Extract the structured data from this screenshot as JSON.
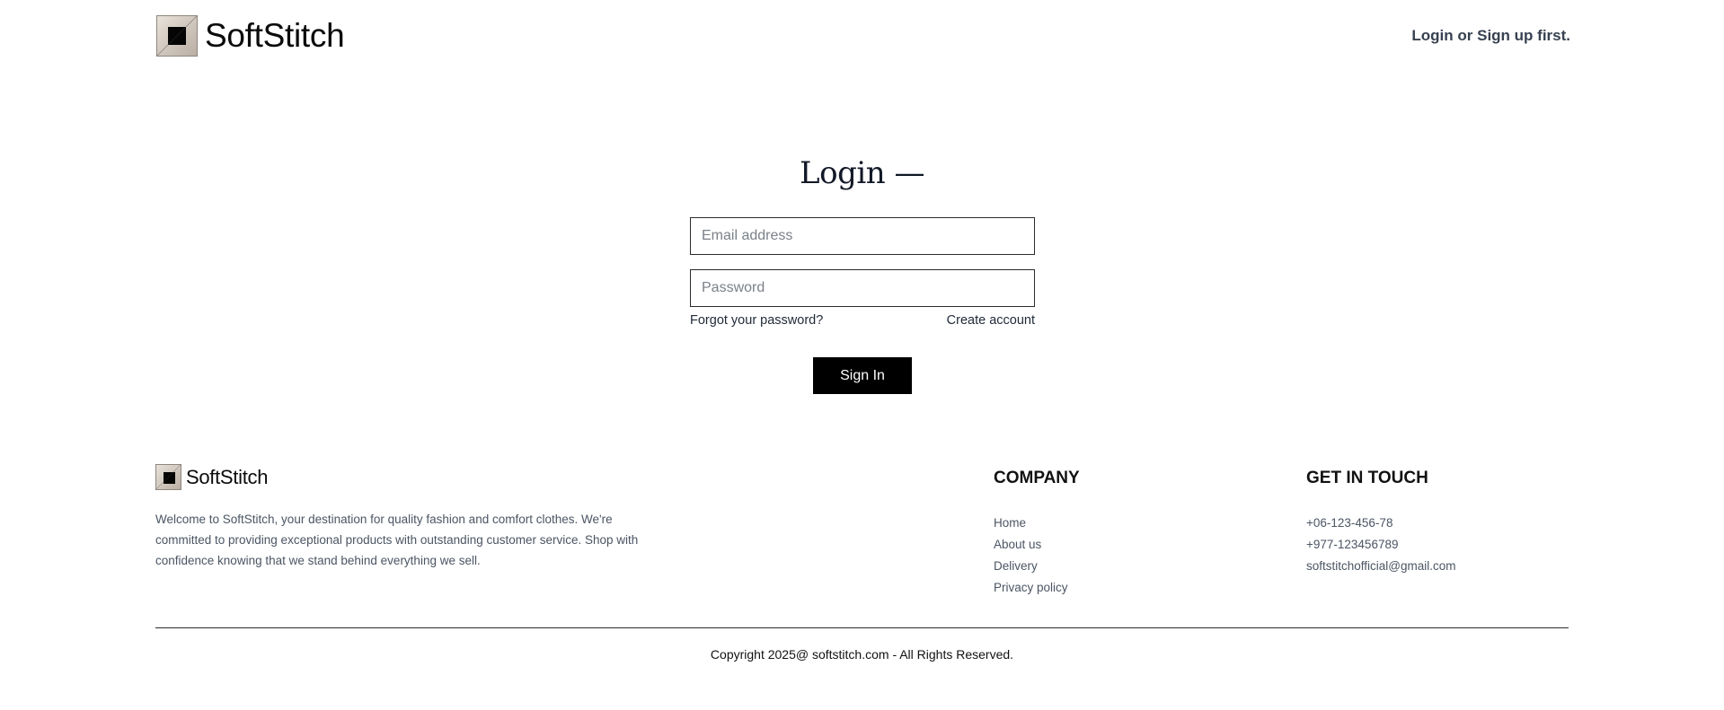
{
  "header": {
    "brand": "SoftStitch",
    "auth_prompt": "Login or Sign up first."
  },
  "login": {
    "title": "Login —",
    "email_placeholder": "Email address",
    "email_value": "",
    "password_placeholder": "Password",
    "password_value": "",
    "forgot_password": "Forgot your password?",
    "create_account": "Create account",
    "sign_in": "Sign In"
  },
  "footer": {
    "brand": "SoftStitch",
    "about": "Welcome to SoftStitch, your destination for quality fashion and comfort clothes. We're committed to providing exceptional products with outstanding customer service. Shop with confidence knowing that we stand behind everything we sell.",
    "company": {
      "heading": "COMPANY",
      "links": [
        "Home",
        "About us",
        "Delivery",
        "Privacy policy"
      ]
    },
    "contact": {
      "heading": "GET IN TOUCH",
      "items": [
        "+06-123-456-78",
        "+977-123456789",
        "softstitchofficial@gmail.com"
      ]
    },
    "copyright": "Copyright 2025@ softstitch.com - All Rights Reserved."
  },
  "icons": {
    "brand_logo": "square-logo-icon"
  },
  "colors": {
    "primary_button": "#000000",
    "text": "#1f2937",
    "muted_text": "#4b5563"
  }
}
